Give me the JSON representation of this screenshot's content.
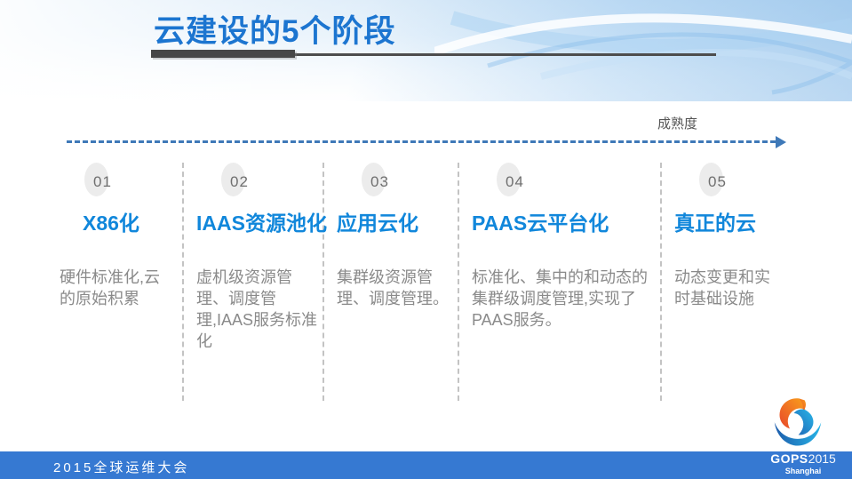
{
  "slide": {
    "title": "云建设的5个阶段",
    "axis": {
      "label": "成熟度"
    },
    "stages": [
      {
        "num": "01",
        "heading": "X86化",
        "desc": "硬件标准化,云的原始积累"
      },
      {
        "num": "02",
        "heading": "IAAS资源池化",
        "desc": "虚机级资源管理、调度管理,IAAS服务标准化"
      },
      {
        "num": "03",
        "heading": "应用云化",
        "desc": "集群级资源管理、调度管理。"
      },
      {
        "num": "04",
        "heading": "PAAS云平台化",
        "desc": "标准化、集中的和动态的集群级调度管理,实现了PAAS服务。"
      },
      {
        "num": "05",
        "heading": "真正的云",
        "desc": "动态变更和实时基础设施"
      }
    ]
  },
  "footer": {
    "conference": "2015全球运维大会",
    "logo": {
      "name": "GOPS",
      "year": "2015",
      "city": "Shanghai"
    }
  },
  "colors": {
    "title_blue": "#1c75d0",
    "stage_heading_blue": "#1187db",
    "body_gray": "#8a8a8a",
    "number_gray": "#6f6f6f",
    "axis_arrow_blue": "#3f79b8",
    "separator_gray": "#c3c3c3",
    "rule_dark_gray": "#474747",
    "footer_bar_blue": "#3679d2",
    "logo_red": "#e8472b",
    "logo_orange": "#f79420",
    "logo_blue": "#1e8fd5"
  }
}
